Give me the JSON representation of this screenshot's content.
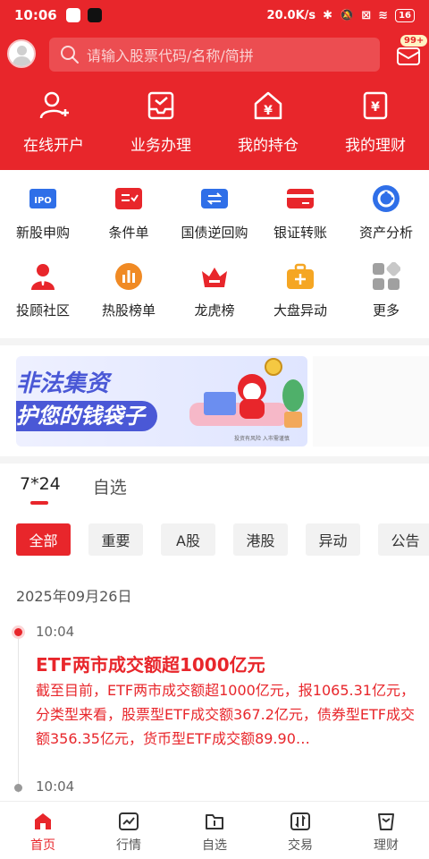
{
  "status_bar": {
    "time": "10:06",
    "net_speed": "20.0K/s",
    "battery": "16"
  },
  "search": {
    "placeholder": "请输入股票代码/名称/简拼"
  },
  "messages": {
    "badge": "99+"
  },
  "top_nav": [
    {
      "label": "在线开户",
      "icon": "add-user-icon"
    },
    {
      "label": "业务办理",
      "icon": "inbox-check-icon"
    },
    {
      "label": "我的持仓",
      "icon": "yen-house-icon"
    },
    {
      "label": "我的理财",
      "icon": "yen-bag-icon"
    }
  ],
  "grid": [
    {
      "label": "新股申购",
      "icon": "ipo-icon",
      "color": "#2f6fe8"
    },
    {
      "label": "条件单",
      "icon": "condition-order-icon",
      "color": "#e8262b"
    },
    {
      "label": "国债逆回购",
      "icon": "repo-icon",
      "color": "#2f6fe8"
    },
    {
      "label": "银证转账",
      "icon": "bank-transfer-icon",
      "color": "#e8262b"
    },
    {
      "label": "资产分析",
      "icon": "pie-chart-icon",
      "color": "#2f6fe8"
    },
    {
      "label": "投顾社区",
      "icon": "advisor-icon",
      "color": "#e8262b"
    },
    {
      "label": "热股榜单",
      "icon": "hot-stocks-icon",
      "color": "#f08a24"
    },
    {
      "label": "龙虎榜",
      "icon": "crown-icon",
      "color": "#e8262b"
    },
    {
      "label": "大盘异动",
      "icon": "briefcase-icon",
      "color": "#f5a623"
    },
    {
      "label": "更多",
      "icon": "more-grid-icon",
      "color": "#a0a0a0"
    }
  ],
  "banner": {
    "line1": "非法集资",
    "line2": "护您的钱袋子",
    "small": "投资有风险 入市需谨慎"
  },
  "tabs": [
    {
      "label": "7*24"
    },
    {
      "label": "自选"
    }
  ],
  "filters": [
    {
      "label": "全部"
    },
    {
      "label": "重要"
    },
    {
      "label": "A股"
    },
    {
      "label": "港股"
    },
    {
      "label": "异动"
    },
    {
      "label": "公告"
    }
  ],
  "feed": {
    "date": "2025年09月26日",
    "items": [
      {
        "time": "10:04",
        "title": "ETF两市成交额超1000亿元",
        "body": "截至目前，ETF两市成交额超1000亿元，报1065.31亿元，分类型来看，股票型ETF成交额367.2亿元，债券型ETF成交额356.35亿元，货币型ETF成交额89.90…"
      },
      {
        "time": "10:04"
      }
    ]
  },
  "bottom_nav": [
    {
      "label": "首页",
      "icon": "home-icon"
    },
    {
      "label": "行情",
      "icon": "market-icon"
    },
    {
      "label": "自选",
      "icon": "watchlist-icon"
    },
    {
      "label": "交易",
      "icon": "trade-icon"
    },
    {
      "label": "理财",
      "icon": "wealth-icon"
    }
  ],
  "colors": {
    "brand": "#e8262b"
  }
}
